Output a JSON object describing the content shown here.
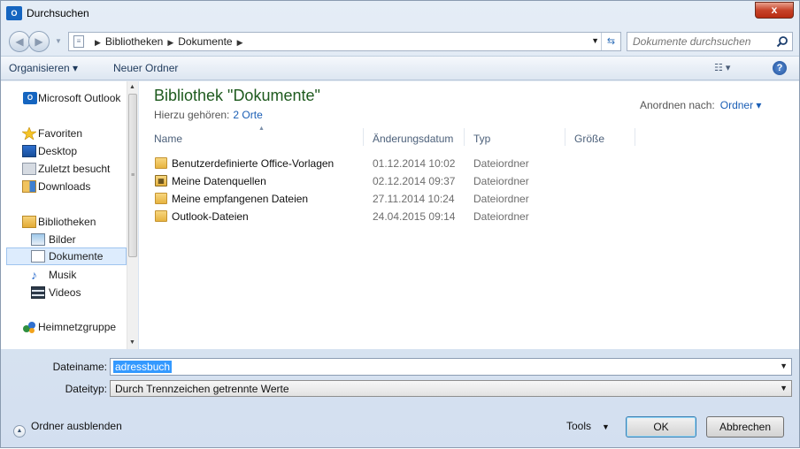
{
  "window": {
    "title": "Durchsuchen",
    "app_icon_text": "O",
    "close_label": "x"
  },
  "address": {
    "crumbs": [
      "Bibliotheken",
      "Dokumente"
    ],
    "search_placeholder": "Dokumente durchsuchen"
  },
  "toolbar": {
    "organize": "Organisieren ▾",
    "new_folder": "Neuer Ordner",
    "help": "?"
  },
  "nav": {
    "items": [
      {
        "label": "Microsoft Outlook",
        "icon": "outlook-icon"
      },
      {
        "label": "Favoriten",
        "icon": "star-icon"
      },
      {
        "label": "Desktop",
        "icon": "desktop-icon"
      },
      {
        "label": "Zuletzt besucht",
        "icon": "recent-places-icon"
      },
      {
        "label": "Downloads",
        "icon": "downloads-icon"
      },
      {
        "label": "Bibliotheken",
        "icon": "libraries-icon"
      },
      {
        "label": "Bilder",
        "icon": "pictures-icon"
      },
      {
        "label": "Dokumente",
        "icon": "documents-icon"
      },
      {
        "label": "Musik",
        "icon": "music-icon"
      },
      {
        "label": "Videos",
        "icon": "videos-icon"
      },
      {
        "label": "Heimnetzgruppe",
        "icon": "homegroup-icon"
      }
    ],
    "selected": "Dokumente"
  },
  "library": {
    "title": "Bibliothek \"Dokumente\"",
    "includes_label": "Hierzu gehören:",
    "includes_link": "2 Orte",
    "arrange_label": "Anordnen nach:",
    "arrange_value": "Ordner ▾"
  },
  "columns": [
    "Name",
    "Änderungsdatum",
    "Typ",
    "Größe"
  ],
  "files": [
    {
      "name": "Benutzerdefinierte Office-Vorlagen",
      "date": "01.12.2014 10:02",
      "type": "Dateiordner",
      "icon": "folder-icon"
    },
    {
      "name": "Meine Datenquellen",
      "date": "02.12.2014 09:37",
      "type": "Dateiordner",
      "icon": "datasource-folder-icon"
    },
    {
      "name": "Meine empfangenen Dateien",
      "date": "27.11.2014 10:24",
      "type": "Dateiordner",
      "icon": "folder-icon"
    },
    {
      "name": "Outlook-Dateien",
      "date": "24.04.2015 09:14",
      "type": "Dateiordner",
      "icon": "folder-icon"
    }
  ],
  "bottom": {
    "filename_label": "Dateiname:",
    "filename_value": "adressbuch",
    "filetype_label": "Dateityp:",
    "filetype_value": "Durch Trennzeichen getrennte Werte",
    "hide_folders": "Ordner ausblenden",
    "tools": "Tools",
    "ok": "OK",
    "cancel": "Abbrechen"
  }
}
